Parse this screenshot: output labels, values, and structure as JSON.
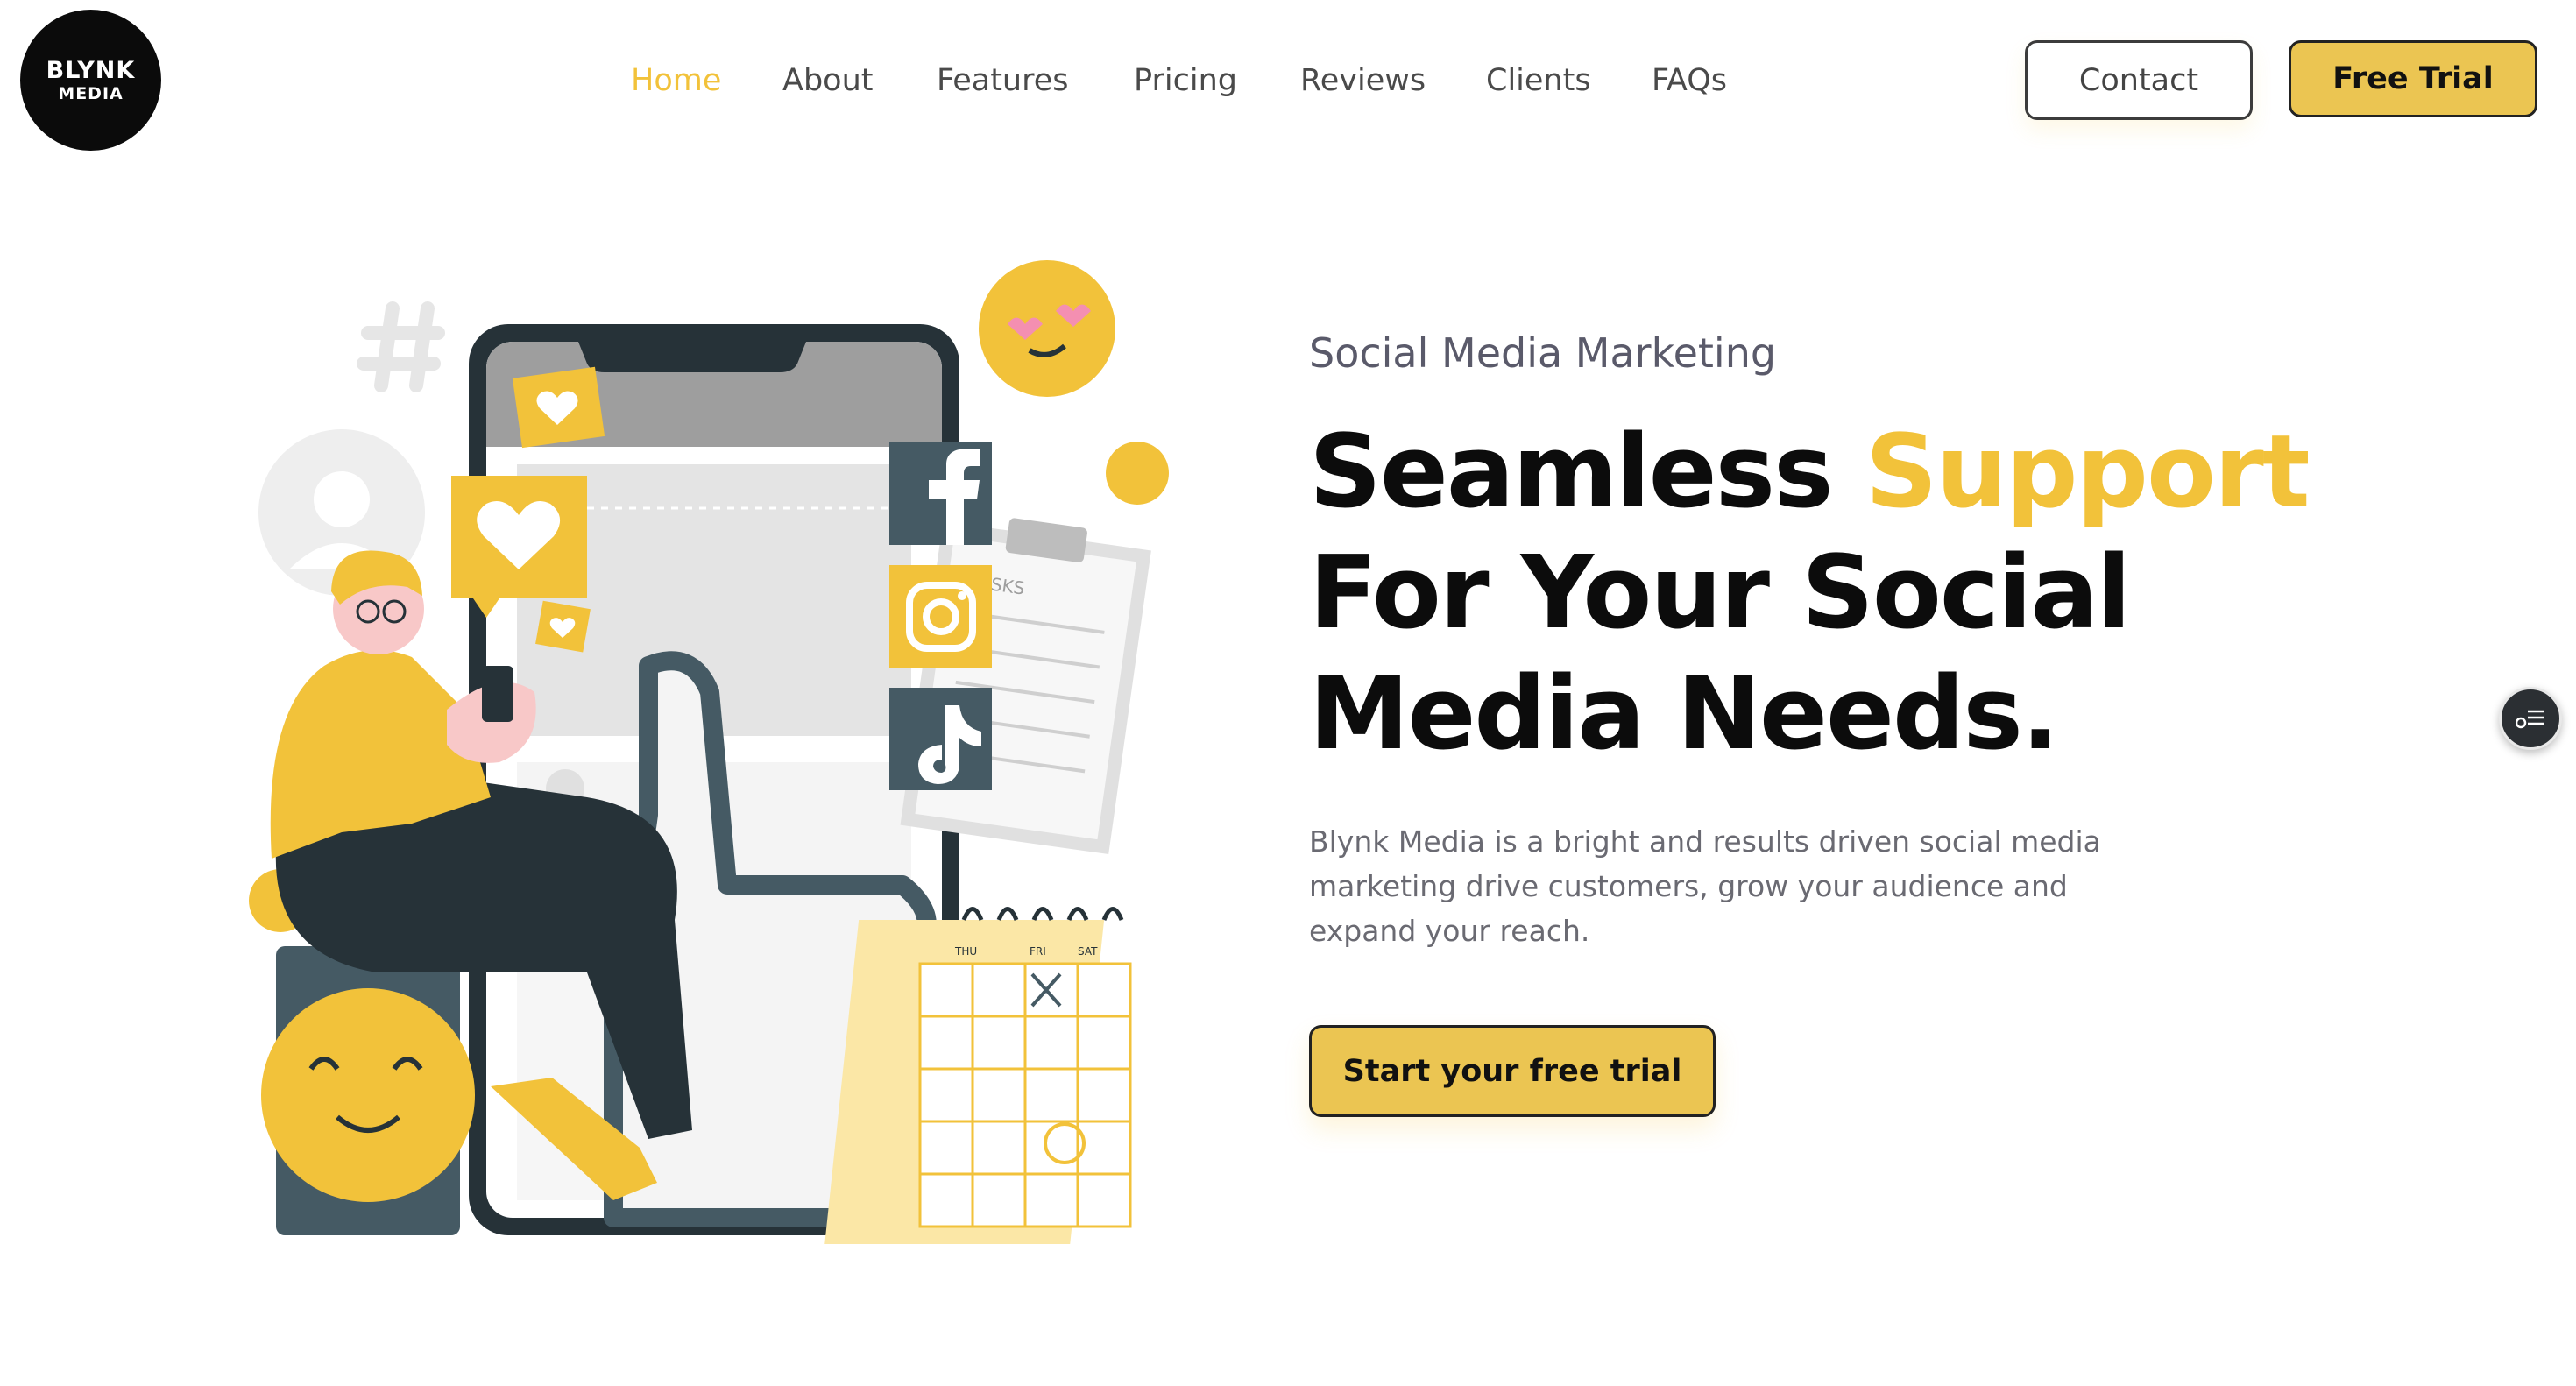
{
  "brand": {
    "logo_line1": "BLYNK",
    "logo_line2": "MEDIA",
    "accent_color": "#f2c23a",
    "button_color": "#ebc552"
  },
  "nav": {
    "items": [
      {
        "label": "Home",
        "active": true
      },
      {
        "label": "About"
      },
      {
        "label": "Features"
      },
      {
        "label": "Pricing"
      },
      {
        "label": "Reviews"
      },
      {
        "label": "Clients"
      },
      {
        "label": "FAQs"
      }
    ]
  },
  "header": {
    "contact_label": "Contact",
    "trial_label": "Free Trial"
  },
  "hero": {
    "eyebrow": "Social Media Marketing",
    "headline_part1": "Seamless ",
    "headline_accent": "Support",
    "headline_line2": "For Your Social",
    "headline_line3": "Media Needs.",
    "description": "Blynk Media is a bright and results driven social media marketing drive customers, grow your audience and expand your reach.",
    "cta_label": "Start your free trial"
  },
  "illustration": {
    "icons": [
      "facebook-icon",
      "instagram-icon",
      "tiktok-icon",
      "heart-icon",
      "smiley-icon",
      "hashtag-icon"
    ],
    "clipboard_label": "TASKS",
    "calendar_days": [
      "THU",
      "FRI",
      "SAT"
    ]
  },
  "widgets": {
    "floating_icon": "settings-list-icon"
  }
}
